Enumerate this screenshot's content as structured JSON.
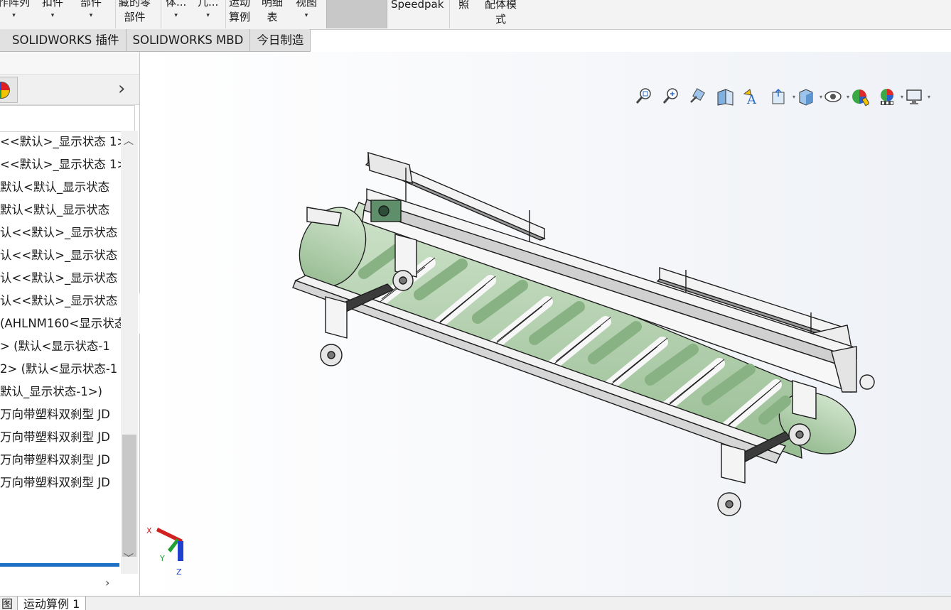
{
  "ribbon": {
    "items": [
      {
        "text": "作阵列",
        "arrow": "▾"
      },
      {
        "text": "扣件",
        "arrow": "▾"
      },
      {
        "text": "部件",
        "arrow": "▾"
      },
      {
        "text": "藏的零",
        "text2": "部件"
      },
      {
        "text": "体...",
        "arrow": "▾"
      },
      {
        "text": "几...",
        "arrow": "▾"
      },
      {
        "text": "运动",
        "text2": "算例"
      },
      {
        "text": "明细",
        "text2": "表"
      },
      {
        "text": "视图",
        "arrow": "▾"
      },
      {
        "text": "Speedpak"
      },
      {
        "text": "照"
      },
      {
        "text": "配体模",
        "text2": "式"
      }
    ]
  },
  "command_tabs": [
    "SOLIDWORKS 插件",
    "SOLIDWORKS MBD",
    "今日制造"
  ],
  "feature_tree": {
    "rows": [
      "<<默认>_显示状态 1>",
      "<<默认>_显示状态 1>",
      "默认<默认_显示状态",
      "默认<默认_显示状态",
      "认<<默认>_显示状态",
      "认<<默认>_显示状态",
      "认<<默认>_显示状态",
      "认<<默认>_显示状态",
      " (AHLNM160<显示状态",
      " > (默认<显示状态-1",
      "2> (默认<显示状态-1",
      "默认_显示状态-1>)",
      "万向带塑料双刹型 JD",
      "万向带塑料双刹型 JD",
      "万向带塑料双刹型 JD",
      "万向带塑料双刹型 JD"
    ]
  },
  "bottom_tabs": [
    "图",
    "运动算例 1"
  ],
  "heads_up_toolbar": [
    {
      "icon": "zoom-to-fit-icon"
    },
    {
      "icon": "zoom-to-area-icon"
    },
    {
      "icon": "previous-view-icon"
    },
    {
      "icon": "section-view-icon"
    },
    {
      "icon": "dynamic-annotation-icon"
    },
    {
      "icon": "view-orientation-icon",
      "dropdown": true
    },
    {
      "icon": "display-style-icon",
      "dropdown": true
    },
    {
      "icon": "hide-show-items-icon",
      "dropdown": true
    },
    {
      "icon": "edit-appearance-icon"
    },
    {
      "icon": "apply-scene-icon",
      "dropdown": true
    },
    {
      "icon": "view-settings-icon",
      "dropdown": true
    }
  ],
  "triad": {
    "x": "X",
    "y": "Y",
    "z": "Z"
  },
  "colors": {
    "accent_blue": "#1f6fc4",
    "belt_green": "#b5d3b0",
    "frame_white": "#f4f4f4",
    "outline": "#1c1c1c"
  }
}
